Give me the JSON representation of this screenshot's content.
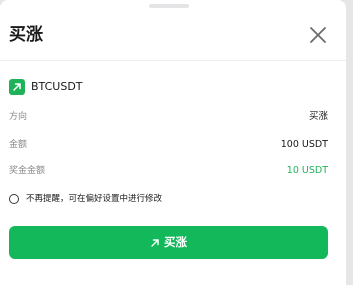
{
  "sheet": {
    "title": "买涨"
  },
  "instrument": {
    "symbol": "BTCUSDT",
    "icon": "arrow-up-right-icon"
  },
  "details": [
    {
      "label": "方向",
      "value": "买涨",
      "color": "#1a1a1a"
    },
    {
      "label": "金额",
      "value": "100 USDT",
      "color": "#1a1a1a"
    },
    {
      "label": "奖金金额",
      "value": "10 USDT",
      "color": "#20b259"
    }
  ],
  "reminder": {
    "text": "不再提醒，可在偏好设置中进行修改",
    "checked": false
  },
  "confirm": {
    "label": "买涨",
    "icon": "arrow-up-right-icon",
    "color": "#12b859"
  }
}
